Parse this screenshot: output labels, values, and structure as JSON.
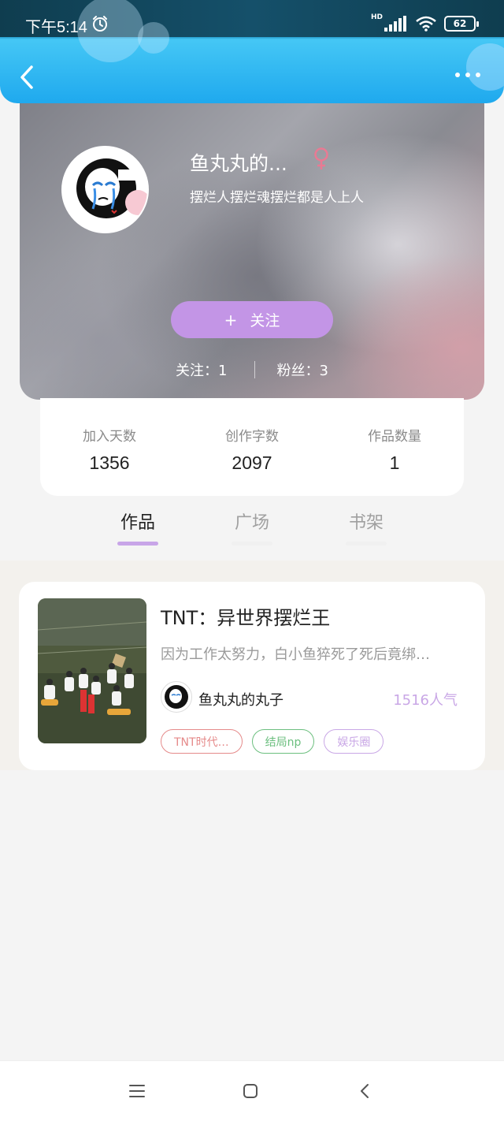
{
  "status_bar": {
    "time": "下午5:14",
    "network_label": "HD",
    "battery": "62"
  },
  "icons": {
    "back": "chevron-left-icon",
    "more": "more-dots-icon",
    "gender": "female-icon",
    "alarm": "alarm-icon"
  },
  "profile": {
    "name": "鱼丸丸的...",
    "bio": "摆烂人摆烂魂摆烂都是人上人",
    "follow_plus": "+",
    "follow_label": "关注",
    "following": "关注：1",
    "fans": "粉丝：3"
  },
  "stats": [
    {
      "label": "加入天数",
      "value": "1356"
    },
    {
      "label": "创作字数",
      "value": "2097"
    },
    {
      "label": "作品数量",
      "value": "1"
    }
  ],
  "tabs": [
    {
      "label": "作品",
      "active": true
    },
    {
      "label": "广场",
      "active": false
    },
    {
      "label": "书架",
      "active": false
    }
  ],
  "works": [
    {
      "title": "TNT：异世界摆烂王",
      "description": "因为工作太努力，白小鱼猝死了死后竟绑…",
      "author": "鱼丸丸的丸子",
      "popularity": "1516人气",
      "tags": [
        {
          "label": "TNT时代…",
          "color": "#e58a8a"
        },
        {
          "label": "结局np",
          "color": "#6cbf7f"
        },
        {
          "label": "娱乐圈",
          "color": "#c9a7e6"
        }
      ]
    }
  ],
  "colors": {
    "accent": "#c395e6",
    "topbar": "#1fa9ee"
  }
}
